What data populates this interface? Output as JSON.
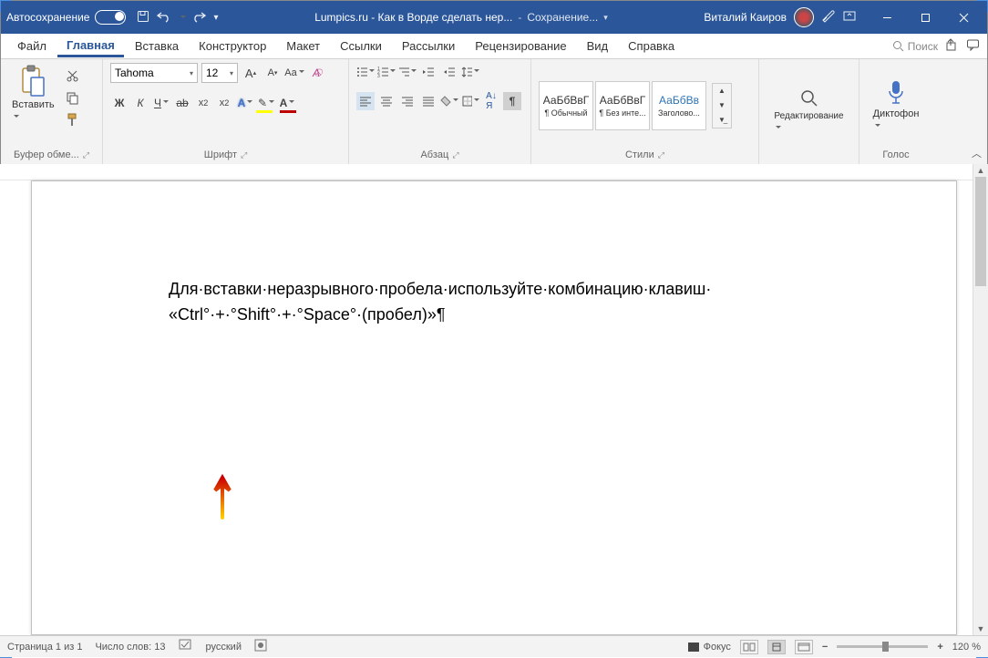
{
  "titlebar": {
    "autosave": "Автосохранение",
    "doc_title": "Lumpics.ru - Как в Ворде сделать нер...",
    "save_status": "Сохранение...",
    "user": "Виталий Каиров"
  },
  "tabs": {
    "file": "Файл",
    "home": "Главная",
    "insert": "Вставка",
    "design": "Конструктор",
    "layout": "Макет",
    "references": "Ссылки",
    "mailings": "Рассылки",
    "review": "Рецензирование",
    "view": "Вид",
    "help": "Справка",
    "search": "Поиск"
  },
  "ribbon": {
    "clipboard": {
      "paste": "Вставить",
      "label": "Буфер обме..."
    },
    "font": {
      "name": "Tahoma",
      "size": "12",
      "label": "Шрифт",
      "bold": "Ж",
      "italic": "К",
      "underline": "Ч",
      "strike": "ab"
    },
    "paragraph": {
      "label": "Абзац"
    },
    "styles": {
      "label": "Стили",
      "s1": {
        "preview": "АаБбВвГ",
        "name": "¶ Обычный"
      },
      "s2": {
        "preview": "АаБбВвГ",
        "name": "¶ Без инте..."
      },
      "s3": {
        "preview": "АаБбВв",
        "name": "Заголово..."
      }
    },
    "editing": {
      "label": "Редактирование"
    },
    "voice": {
      "label": "Голос",
      "dictate": "Диктофон"
    }
  },
  "document": {
    "line1": "Для·вставки·неразрывного·пробела·используйте·комбинацию·клавиш·",
    "line2": "«Ctrl°·+·°Shift°·+·°Space°·(пробел)»¶"
  },
  "statusbar": {
    "page": "Страница 1 из 1",
    "words": "Число слов: 13",
    "lang": "русский",
    "focus": "Фокус",
    "zoom": "120 %"
  }
}
